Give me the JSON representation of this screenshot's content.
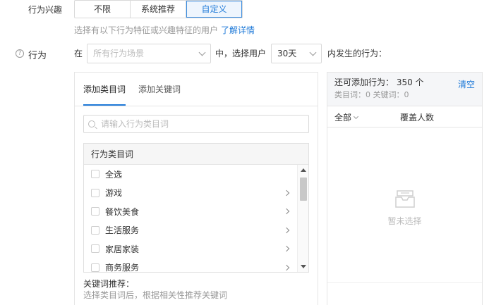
{
  "interest": {
    "label": "行为兴趣",
    "options": [
      "不限",
      "系统推荐",
      "自定义"
    ],
    "selected_index": 2,
    "hint": "选择有以下行为特征或兴趣特征的用户",
    "hint_link": "了解详情"
  },
  "behavior": {
    "help_icon": "?",
    "label": "行为",
    "text_in": "在",
    "scene_placeholder": "所有行为场景",
    "text_mid": "中，选择用户",
    "days_value": "30天",
    "text_end": "内发生的行为："
  },
  "left_panel": {
    "tabs": [
      {
        "label": "添加类目词",
        "active": true
      },
      {
        "label": "添加关键词",
        "active": false
      }
    ],
    "search_placeholder": "请输入行为类目词",
    "category_header": "行为类目词",
    "categories": [
      {
        "label": "全选",
        "has_children": false
      },
      {
        "label": "游戏",
        "has_children": true
      },
      {
        "label": "餐饮美食",
        "has_children": true
      },
      {
        "label": "生活服务",
        "has_children": true
      },
      {
        "label": "家居家装",
        "has_children": true
      },
      {
        "label": "商务服务",
        "has_children": true
      }
    ],
    "keyword_title": "关键词推荐：",
    "keyword_hint": "选择类目词后，根据相关性推荐关键词"
  },
  "right_panel": {
    "count_text": "还可添加行为：  350 个",
    "sub_text": "类目词：0    关键词：0",
    "clear_label": "清空",
    "col_all": "全部",
    "col_cover": "覆盖人数",
    "empty_text": "暂未选择"
  },
  "colors": {
    "accent": "#1f7ad8",
    "border": "#d9d9d9",
    "muted": "#999999"
  }
}
